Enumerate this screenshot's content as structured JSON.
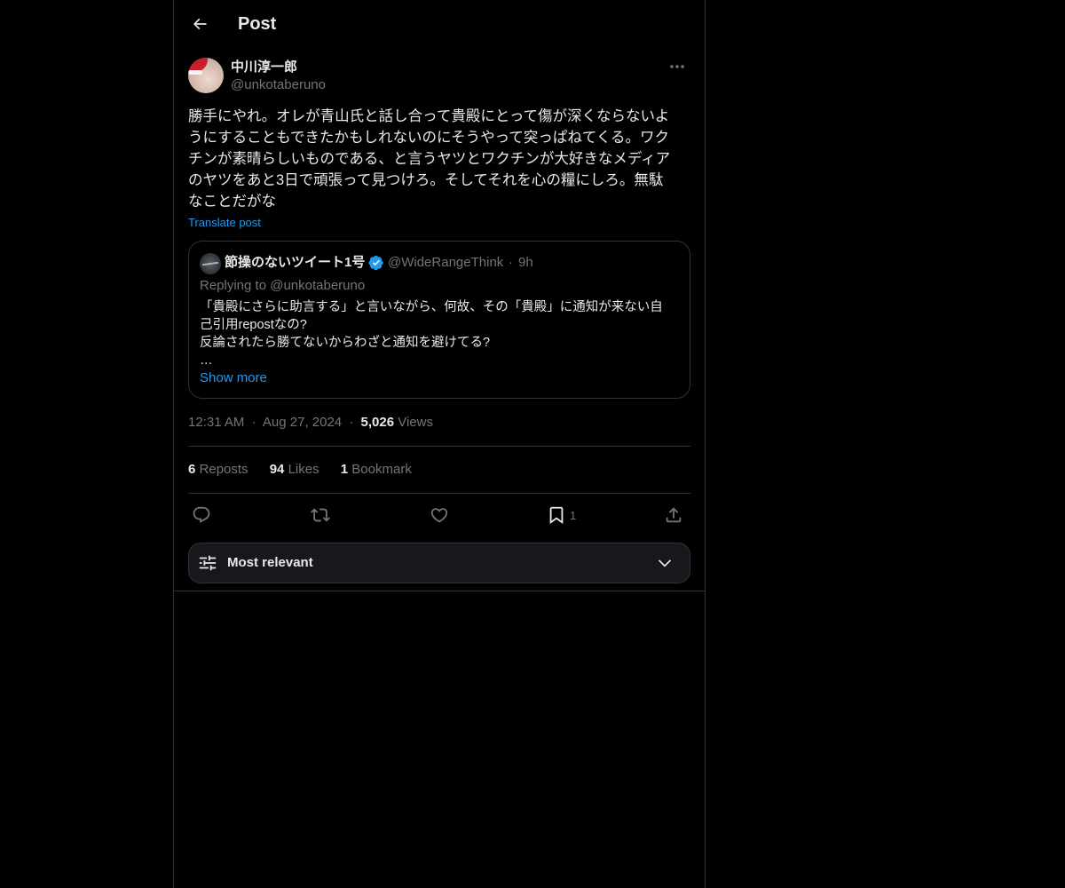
{
  "header": {
    "title": "Post"
  },
  "post": {
    "author": {
      "display_name": "中川淳一郎",
      "handle": "@unkotaberuno"
    },
    "text": "勝手にやれ。オレが青山氏と話し合って貴殿にとって傷が深くならないよ\nうにすることもできたかもしれないのにそうやって突っぱねてくる。ワク\nチンが素晴らしいものである、と言うヤツとワクチンが大好きなメディア\nのヤツをあと3日で頑張って見つけろ。そしてそれを心の糧にしろ。無駄\nなことだがな",
    "translate_label": "Translate post",
    "quote": {
      "display_name": "節操のないツイート1号",
      "handle": "@WideRangeThink",
      "separator": "·",
      "time": "9h",
      "replying_to": "Replying to @unkotaberuno",
      "text": "「貴殿にさらに助言する」と言いながら、何故、その「貴殿」に通知が来ない自\n己引用repostなの?\n反論されたら勝てないからわざと通知を避けてる?\n…",
      "show_more": "Show more",
      "verified_color": "#1d9bf0"
    },
    "timestamp": {
      "time": "12:31 AM",
      "date": "Aug 27, 2024",
      "views_count": "5,026",
      "views_label": "Views",
      "separator": "·"
    },
    "stats": {
      "reposts_count": "6",
      "reposts_label": "Reposts",
      "likes_count": "94",
      "likes_label": "Likes",
      "bookmarks_count": "1",
      "bookmarks_label": "Bookmark"
    },
    "actions": {
      "reply_icon": "reply-icon",
      "repost_icon": "repost-icon",
      "like_icon": "like-icon",
      "bookmark_icon": "bookmark-icon",
      "bookmark_count": "1",
      "share_icon": "share-icon"
    }
  },
  "replies_sort": {
    "label": "Most relevant",
    "icon": "sliders-icon"
  },
  "colors": {
    "background": "#000000",
    "text": "#e7e9ea",
    "secondary_text": "#71767b",
    "accent": "#1d9bf0",
    "border": "#2f3336"
  }
}
